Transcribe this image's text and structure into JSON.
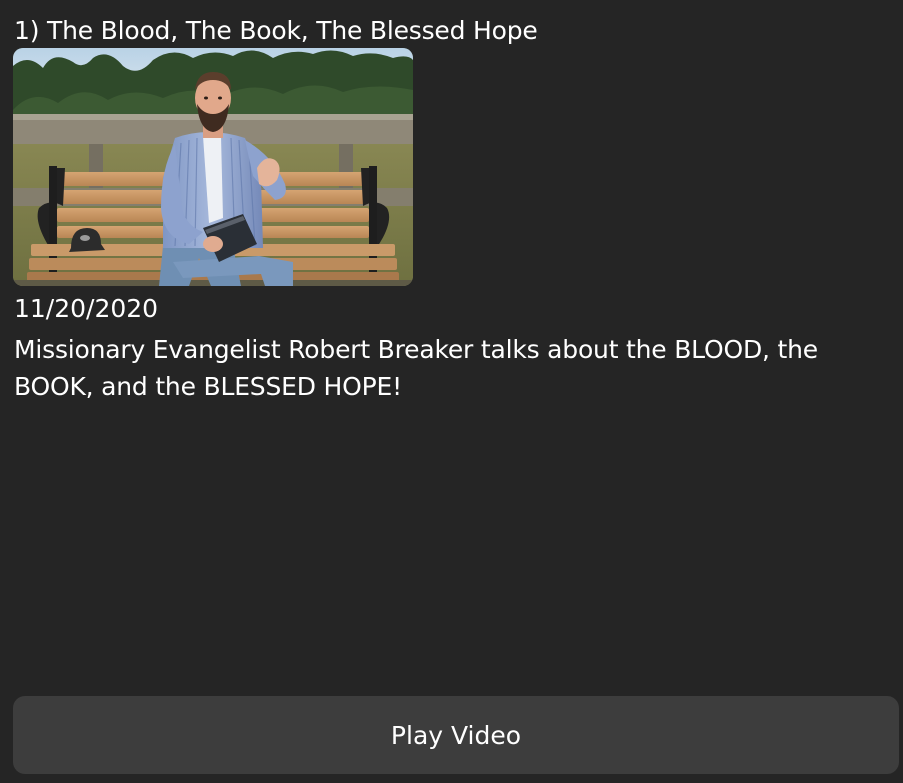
{
  "video": {
    "title": "1) The Blood, The Book, The Blessed Hope",
    "thumbnail_alt": "Man in striped shirt holding a Bible seated on a wooden park bench outdoors",
    "date": "11/20/2020",
    "description": "Missionary Evangelist Robert Breaker talks about the BLOOD, the BOOK, and the BLESSED HOPE!"
  },
  "actions": {
    "play_label": "Play Video"
  },
  "colors": {
    "background": "#252525",
    "button_bg": "#3d3d3d",
    "text": "#ffffff"
  }
}
